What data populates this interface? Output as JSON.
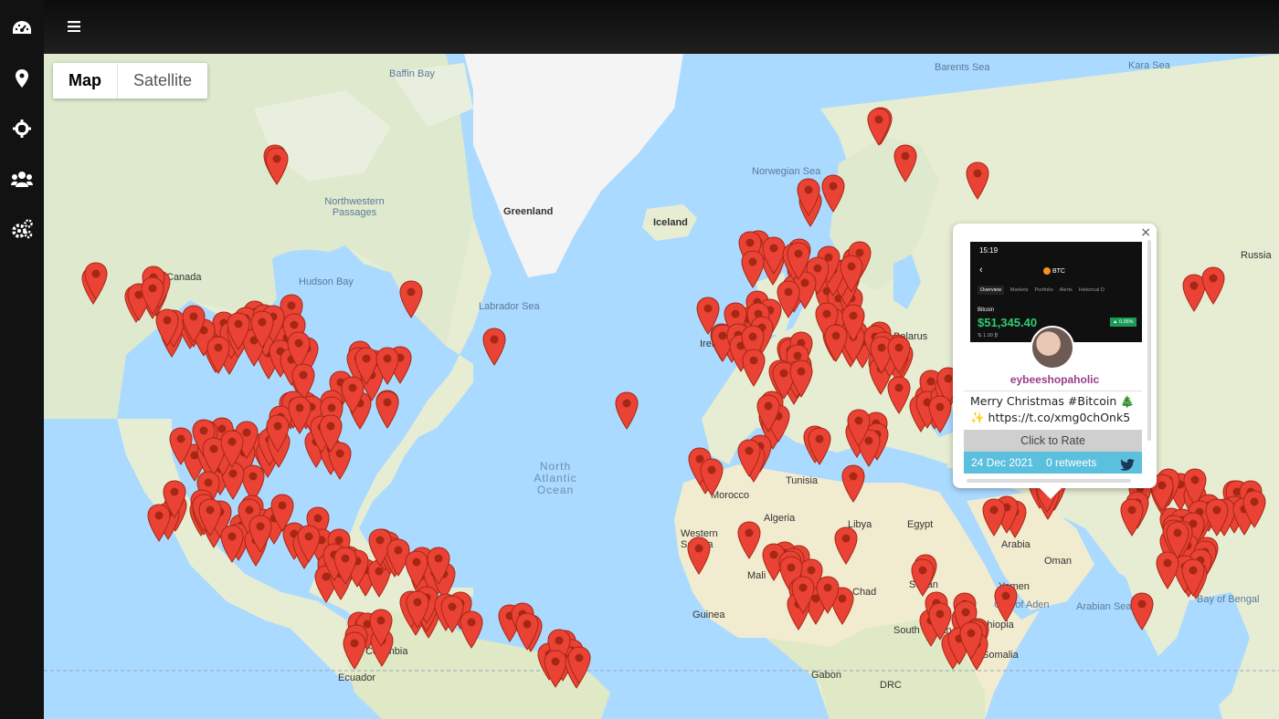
{
  "nav": {
    "icons": [
      "dashboard-icon",
      "location-pin-icon",
      "crosshair-icon",
      "users-icon",
      "settings-icon"
    ]
  },
  "map": {
    "type_buttons": {
      "map": "Map",
      "satellite": "Satellite"
    },
    "labels": [
      {
        "text": "Baffin Bay",
        "kind": "sea"
      },
      {
        "text": "Barents Sea",
        "kind": "sea"
      },
      {
        "text": "Kara Sea",
        "kind": "sea"
      },
      {
        "text": "Norwegian Sea",
        "kind": "sea"
      },
      {
        "text": "Northwestern Passages",
        "kind": "sea"
      },
      {
        "text": "Greenland",
        "kind": "land"
      },
      {
        "text": "Iceland",
        "kind": "land"
      },
      {
        "text": "Canada",
        "kind": "land"
      },
      {
        "text": "Hudson Bay",
        "kind": "sea"
      },
      {
        "text": "Labrador Sea",
        "kind": "sea"
      },
      {
        "text": "North Atlantic Ocean",
        "kind": "ocean"
      },
      {
        "text": "Russia",
        "kind": "land"
      },
      {
        "text": "Algeria",
        "kind": "land"
      },
      {
        "text": "Libya",
        "kind": "land"
      },
      {
        "text": "Egypt",
        "kind": "land"
      },
      {
        "text": "Western Sahara",
        "kind": "land"
      },
      {
        "text": "Mali",
        "kind": "land"
      },
      {
        "text": "Chad",
        "kind": "land"
      },
      {
        "text": "Sudan",
        "kind": "land"
      },
      {
        "text": "Ethiopia",
        "kind": "land"
      },
      {
        "text": "Somalia",
        "kind": "land"
      },
      {
        "text": "Yemen",
        "kind": "land"
      },
      {
        "text": "Oman",
        "kind": "land"
      },
      {
        "text": "Arabia",
        "kind": "land"
      },
      {
        "text": "Arabian Sea",
        "kind": "sea"
      },
      {
        "text": "Bay of Bengal",
        "kind": "sea"
      },
      {
        "text": "Gulf of Aden",
        "kind": "sea"
      },
      {
        "text": "Colombia",
        "kind": "land"
      },
      {
        "text": "Ecuador",
        "kind": "land"
      },
      {
        "text": "Gabon",
        "kind": "land"
      },
      {
        "text": "DRC",
        "kind": "land"
      },
      {
        "text": "Tunisia",
        "kind": "land"
      },
      {
        "text": "Morocco",
        "kind": "land"
      },
      {
        "text": "Guinea",
        "kind": "land"
      },
      {
        "text": "South Sudan",
        "kind": "land"
      },
      {
        "text": "Belarus",
        "kind": "land"
      },
      {
        "text": "Ireland",
        "kind": "land"
      }
    ]
  },
  "popup": {
    "screenshot": {
      "time": "15:19",
      "coin": "BTC",
      "tabs": [
        "Overview",
        "Markets",
        "Portfolio",
        "Alerts",
        "Historical D"
      ],
      "name": "Bitcoin",
      "price": "$51,345.40",
      "change": "▲ 0.36%",
      "sub": "⇅ 1.00 ₿"
    },
    "username": "eybeeshopaholic",
    "tweet_text": "Merry Christmas #Bitcoin 🎄 ✨ https://t.co/xmg0chOnk5",
    "rate_label": "Click to Rate",
    "date": "24 Dec 2021",
    "retweets": "0 retweets",
    "close_label": "×"
  },
  "colors": {
    "marker": "#ea4335",
    "marker_dark": "#a52714",
    "water": "#aadaff",
    "land": "#e8f0d8",
    "ice": "#f2f2f2",
    "popup_meta": "#5bc0de",
    "username": "#9a3d8c"
  }
}
